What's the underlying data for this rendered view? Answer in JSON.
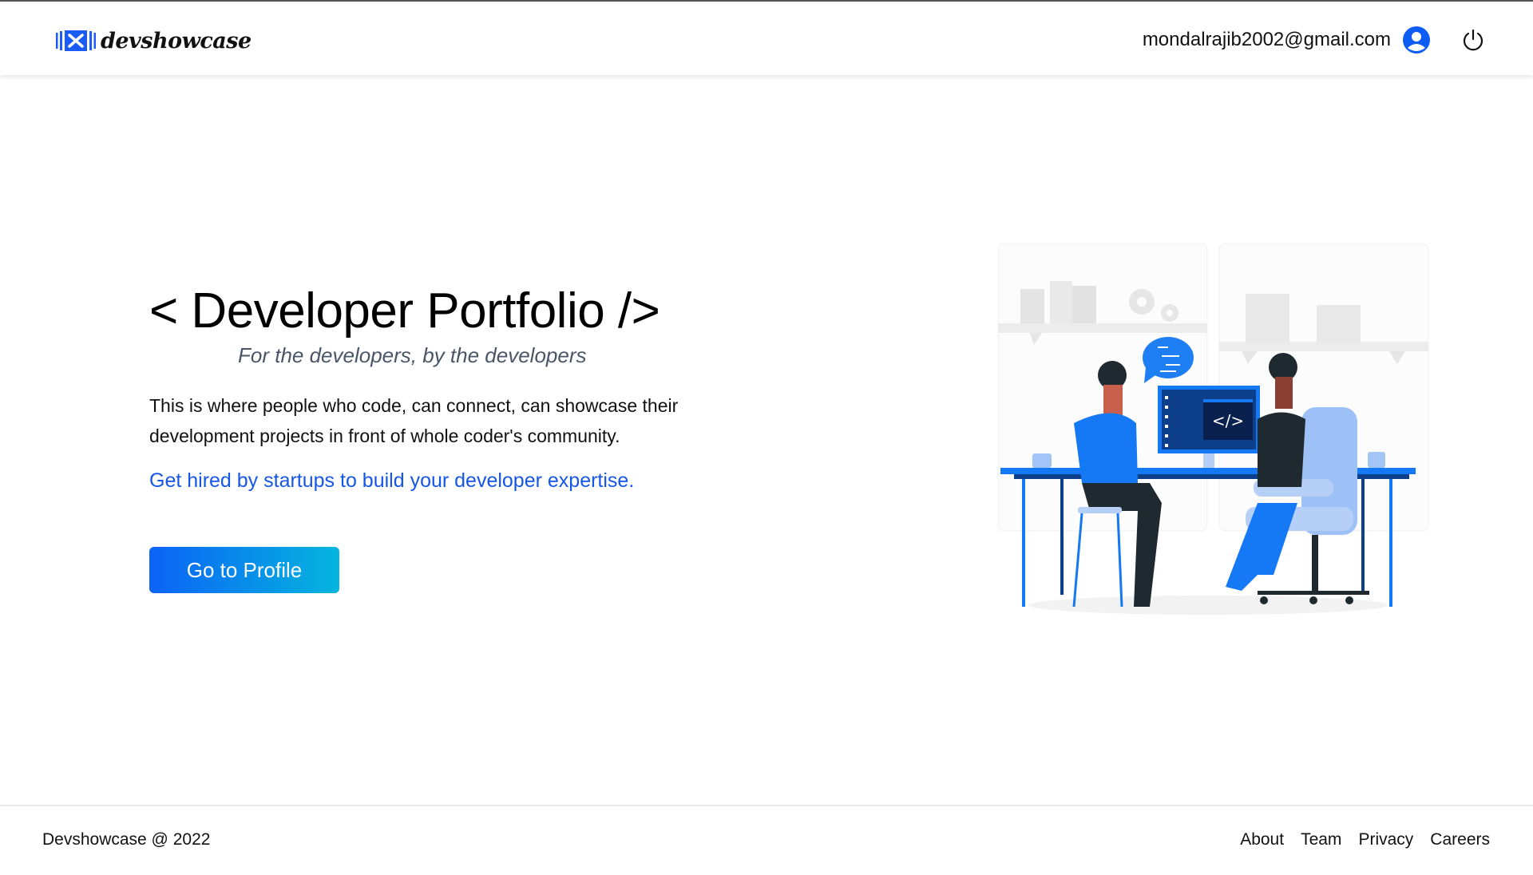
{
  "header": {
    "brand": "devshowcase",
    "logo_icon": "tools-icon",
    "user_email": "mondalrajib2002@gmail.com",
    "user_icon": "user-circle-icon",
    "logout_icon": "power-icon"
  },
  "hero": {
    "title": "< Developer Portfolio />",
    "subtitle": "For the developers, by the developers",
    "description": "This is where people who code, can connect, can showcase their development projects in front of whole coder's community.",
    "cta_text": "Get hired by startups to build your developer expertise.",
    "button_label": "Go to Profile",
    "illustration": "developers-at-desk-illustration",
    "screen_code_label": "</>"
  },
  "colors": {
    "accent": "#1556e8",
    "button_gradient_start": "#0b63f6",
    "button_gradient_end": "#04b5de",
    "subtitle": "#4a5568"
  },
  "footer": {
    "copyright": "Devshowcase @ 2022",
    "links": [
      {
        "label": "About"
      },
      {
        "label": "Team"
      },
      {
        "label": "Privacy"
      },
      {
        "label": "Careers"
      }
    ]
  }
}
